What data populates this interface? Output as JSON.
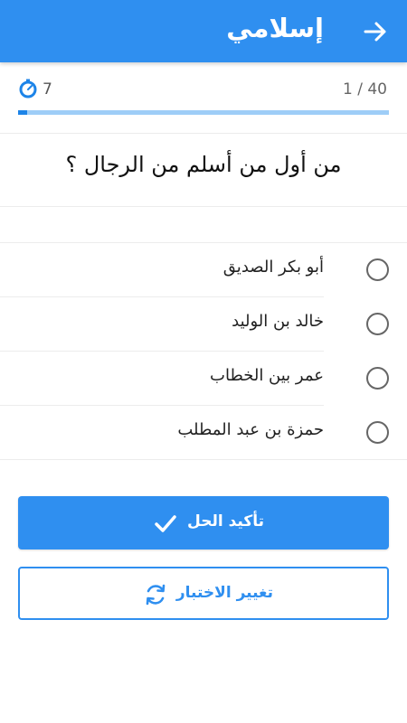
{
  "header": {
    "title": "إسلامي",
    "back_icon": "arrow-right-icon",
    "color": "#2f8ff0"
  },
  "progress": {
    "timer_icon": "stopwatch-icon",
    "timer_value": "7",
    "counter": "1 / 40",
    "fraction": 0.025
  },
  "question": {
    "text": "من أول من أسلم من الرجال ؟"
  },
  "options": [
    {
      "label": "أبو بكر الصديق",
      "selected": false
    },
    {
      "label": "خالد بن الوليد",
      "selected": false
    },
    {
      "label": "عمر بين الخطاب",
      "selected": false
    },
    {
      "label": "حمزة بن عبد المطلب",
      "selected": false
    }
  ],
  "actions": {
    "confirm_label": "تأكيد الحل",
    "confirm_icon": "checkmark-icon",
    "change_label": "تغيير الاختبار",
    "change_icon": "refresh-icon"
  }
}
